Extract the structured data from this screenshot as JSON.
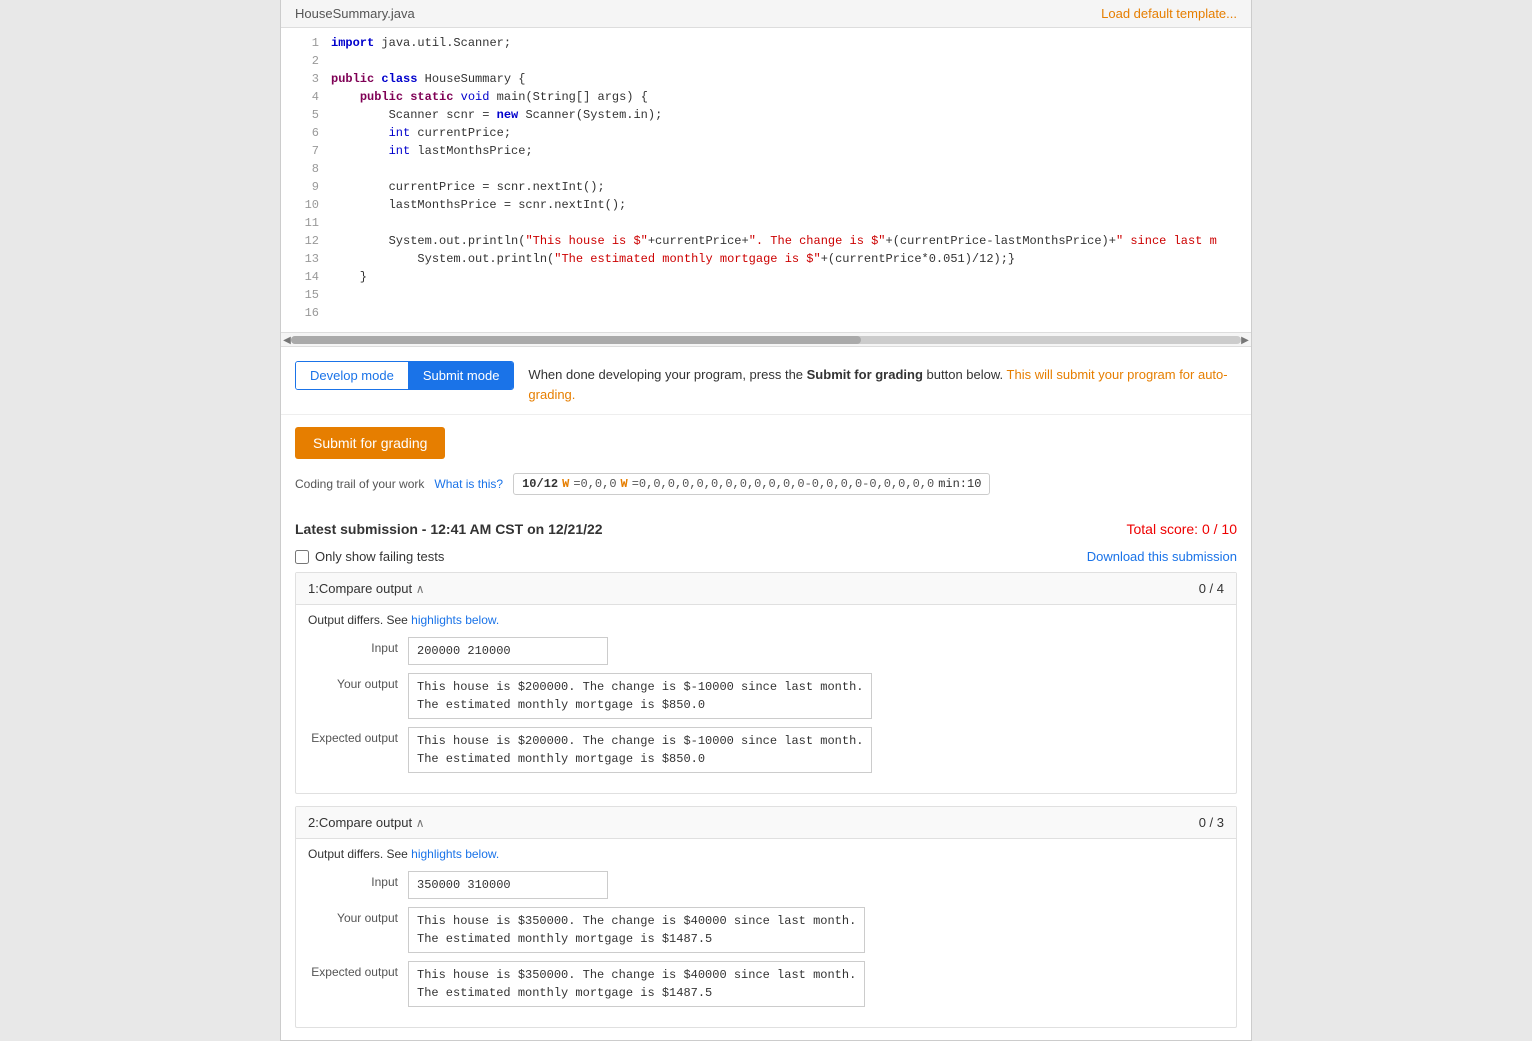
{
  "header": {
    "filename": "HouseSummary.java",
    "load_template_label": "Load default template..."
  },
  "code": {
    "lines": [
      {
        "num": 1,
        "text": "import java.util.Scanner;"
      },
      {
        "num": 2,
        "text": ""
      },
      {
        "num": 3,
        "text": "public class HouseSummary {"
      },
      {
        "num": 4,
        "text": "    public static void main(String[] args) {"
      },
      {
        "num": 5,
        "text": "        Scanner scnr = new Scanner(System.in);"
      },
      {
        "num": 6,
        "text": "        int currentPrice;"
      },
      {
        "num": 7,
        "text": "        int lastMonthsPrice;"
      },
      {
        "num": 8,
        "text": ""
      },
      {
        "num": 9,
        "text": "        currentPrice = scnr.nextInt();"
      },
      {
        "num": 10,
        "text": "        lastMonthsPrice = scnr.nextInt();"
      },
      {
        "num": 11,
        "text": ""
      },
      {
        "num": 12,
        "text": "        System.out.println(\"This house is $\"+currentPrice+\". The change is $\"+(currentPrice-lastMonthsPrice)+\" since last m"
      },
      {
        "num": 13,
        "text": "            System.out.println(\"The estimated monthly mortgage is $\"+(currentPrice*0.051)/12);}"
      },
      {
        "num": 14,
        "text": "    }"
      },
      {
        "num": 15,
        "text": ""
      },
      {
        "num": 16,
        "text": ""
      }
    ]
  },
  "modes": {
    "develop_label": "Develop mode",
    "submit_label": "Submit mode",
    "description_prefix": "When done developing your program, press the ",
    "description_bold": "Submit for grading",
    "description_suffix": " button below.",
    "description_orange": " This will submit your program for auto-grading."
  },
  "submit_button": {
    "label": "Submit for grading"
  },
  "coding_trail": {
    "label": "Coding trail of your work",
    "what_label": "What is this?",
    "trail_display": "10/12 W=0,0,0  W=0,0,0,0,0,0,0,0,0,0,0-0,0,0,0-0,0,0,0,0  min:10"
  },
  "submission": {
    "title": "Latest submission - 12:41 AM CST on 12/21/22",
    "total_score_label": "Total score: 0 / 10",
    "filter_label": "Only show failing tests",
    "download_label": "Download this submission"
  },
  "tests": [
    {
      "id": "1",
      "title": "1:Compare output",
      "score": "0 / 4",
      "output_differs": "Output differs. See highlights below.",
      "input_label": "Input",
      "input_value": "200000 210000",
      "your_output_label": "Your output",
      "your_output_lines": [
        "This house is $200000. The change is $-10000 since last month.",
        "The estimated monthly mortgage is $850.0"
      ],
      "expected_output_label": "Expected output",
      "expected_output_lines": [
        "This house is $200000. The change is $-10000 since last month.",
        "The estimated monthly mortgage is $850.0"
      ],
      "expected_highlight": true
    },
    {
      "id": "2",
      "title": "2:Compare output",
      "score": "0 / 3",
      "output_differs": "Output differs. See highlights below.",
      "input_label": "Input",
      "input_value": "350000 310000",
      "your_output_label": "Your output",
      "your_output_lines": [
        "This house is $350000. The change is $40000 since last month.",
        "The estimated monthly mortgage is $1487.5"
      ],
      "expected_output_label": "Expected output",
      "expected_output_lines": [
        "This house is $350000. The change is $40000 since last month.",
        "The estimated monthly mortgage is $1487.5"
      ],
      "expected_highlight": true
    }
  ]
}
